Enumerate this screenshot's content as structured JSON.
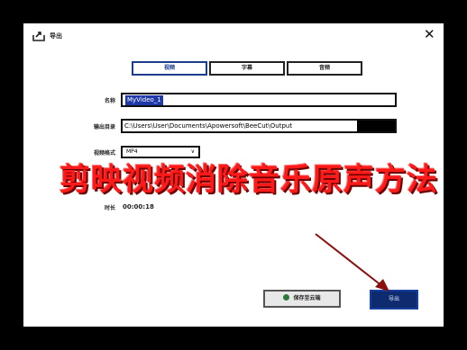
{
  "header": {
    "title": "导出",
    "close": "✕"
  },
  "tabs": [
    {
      "label": "视频",
      "active": true
    },
    {
      "label": "字幕",
      "active": false
    },
    {
      "label": "音频",
      "active": false
    }
  ],
  "form": {
    "name_label": "名称",
    "name_value": "MyVideo_1",
    "dir_label": "输出目录",
    "dir_value": "C:\\Users\\User\\Documents\\Apowersoft\\BeeCut\\Output",
    "format_label": "视频格式",
    "format_value": "MP4",
    "duration_label": "时长",
    "duration_value": "00:00:18"
  },
  "buttons": {
    "cloud": "保存至云端",
    "export": "导出"
  },
  "overlay": {
    "text": "剪映视频消除音乐原声方法"
  },
  "colors": {
    "accent": "#1c3c8c",
    "overlay": "#ff1a1a",
    "export_bg": "#0d2b6e"
  }
}
